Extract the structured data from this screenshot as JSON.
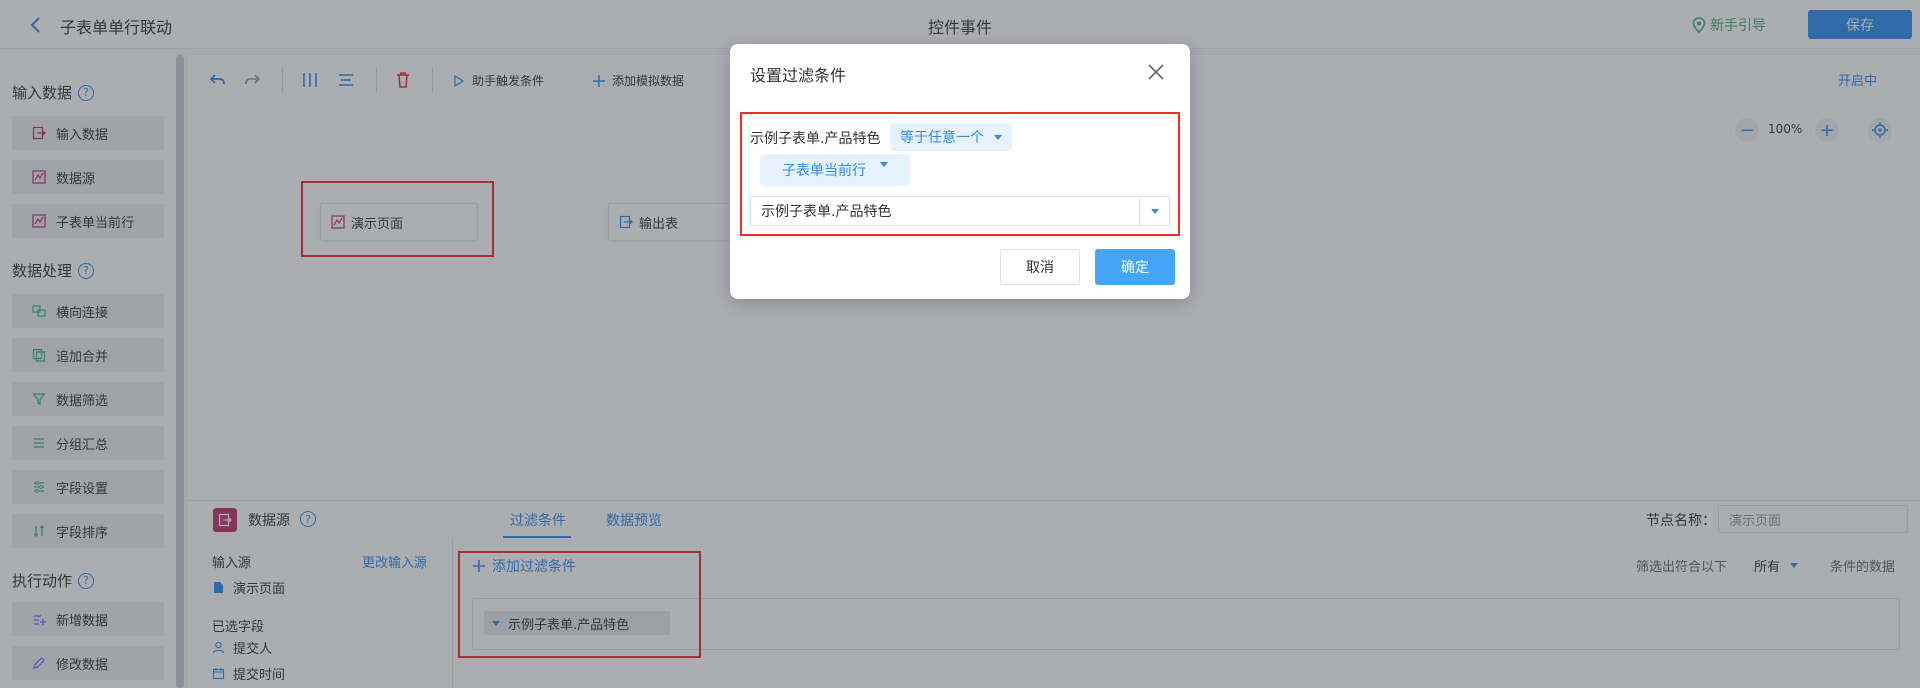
{
  "header": {
    "app_title": "子表单单行联动",
    "center_title": "控件事件",
    "guide_label": "新手引导",
    "save_label": "保存"
  },
  "sidebar": {
    "input_section": "输入数据",
    "input_items": [
      "输入数据",
      "数据源",
      "子表单当前行"
    ],
    "process_section": "数据处理",
    "process_items": [
      "横向连接",
      "追加合并",
      "数据筛选",
      "分组汇总",
      "字段设置",
      "字段排序"
    ],
    "action_section": "执行动作",
    "action_items": [
      "新增数据",
      "修改数据"
    ]
  },
  "toolbar": {
    "trigger_label": "助手触发条件",
    "mock_label": "添加模拟数据",
    "status": "开启中",
    "zoom": "100%"
  },
  "canvas": {
    "node_demo": "演示页面",
    "node_output": "输出表"
  },
  "bottom": {
    "title": "数据源",
    "tab_filter": "过滤条件",
    "tab_preview": "数据预览",
    "node_name_label": "节点名称：",
    "node_name_placeholder": "演示页面",
    "input_source_label": "输入源",
    "change_source": "更改输入源",
    "source_value": "演示页面",
    "selected_fields_label": "已选字段",
    "fields": [
      "提交人",
      "提交时间"
    ],
    "add_filter": "添加过滤条件",
    "filter_chip": "示例子表单.产品特色",
    "filter_lead": "筛选出符合以下",
    "filter_select": "所有",
    "filter_tail": "条件的数据"
  },
  "dialog": {
    "title": "设置过滤条件",
    "field_label": "示例子表单.产品特色",
    "operator": "等于任意一个",
    "value_source": "子表单当前行",
    "combo_value": "示例子表单.产品特色",
    "cancel": "取消",
    "ok": "确定"
  }
}
